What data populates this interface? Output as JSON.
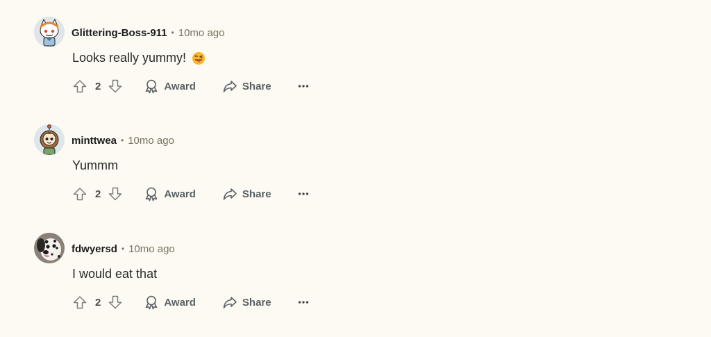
{
  "comments": [
    {
      "username": "Glittering-Boss-911",
      "separator": "•",
      "time": "10mo ago",
      "body": "Looks really yummy!",
      "has_emoji": true,
      "emoji_icon": "face-with-tongue-icon",
      "votes": "2",
      "award_label": "Award",
      "share_label": "Share",
      "avatar_icon": "snoo-avatar-icon"
    },
    {
      "username": "minttwea",
      "separator": "•",
      "time": "10mo ago",
      "body": "Yummm",
      "has_emoji": false,
      "votes": "2",
      "award_label": "Award",
      "share_label": "Share",
      "avatar_icon": "snoo-avatar-icon"
    },
    {
      "username": "fdwyersd",
      "separator": "•",
      "time": "10mo ago",
      "body": "I would eat that",
      "has_emoji": false,
      "votes": "2",
      "award_label": "Award",
      "share_label": "Share",
      "avatar_icon": "dalmatian-avatar-icon"
    }
  ],
  "colors": {
    "background": "#fcfaf2",
    "meta_text": "#7a7263",
    "action_text": "#5a6064"
  }
}
